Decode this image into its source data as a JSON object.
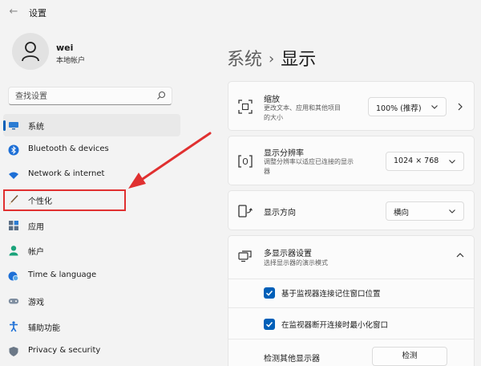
{
  "app": {
    "title": "设置"
  },
  "user": {
    "name": "wei",
    "account_type": "本地帐户"
  },
  "search": {
    "placeholder": "查找设置"
  },
  "sidebar": {
    "items": [
      {
        "label": "系统",
        "icon": "display-icon",
        "active": true
      },
      {
        "label": "Bluetooth & devices",
        "icon": "bluetooth-icon"
      },
      {
        "label": "Network & internet",
        "icon": "wifi-icon"
      },
      {
        "label": "个性化",
        "icon": "brush-icon"
      },
      {
        "label": "应用",
        "icon": "apps-icon"
      },
      {
        "label": "帐户",
        "icon": "person-icon"
      },
      {
        "label": "Time & language",
        "icon": "globe-clock-icon"
      },
      {
        "label": "游戏",
        "icon": "gamepad-icon"
      },
      {
        "label": "辅助功能",
        "icon": "accessibility-icon"
      },
      {
        "label": "Privacy & security",
        "icon": "shield-icon"
      }
    ]
  },
  "breadcrumb": {
    "parent": "系统",
    "separator": "›",
    "current": "显示"
  },
  "scale": {
    "title": "缩放",
    "desc_line1": "更改文本、应用和其他项目",
    "desc_line2": "的大小",
    "value": "100% (推荐)"
  },
  "resolution": {
    "title": "显示分辨率",
    "desc_line1": "调整分辨率以适应已连接的显示",
    "desc_line2": "器",
    "value": "1024 × 768"
  },
  "orientation": {
    "title": "显示方向",
    "value": "横向"
  },
  "multi_display": {
    "title": "多显示器设置",
    "desc": "选择显示器的演示模式",
    "option1": "基于监视器连接记住窗口位置",
    "option2": "在监视器断开连接时最小化窗口",
    "detect_label": "检测其他显示器",
    "detect_button": "检测"
  },
  "colors": {
    "accent": "#005fb8",
    "highlight": "#e03030"
  }
}
